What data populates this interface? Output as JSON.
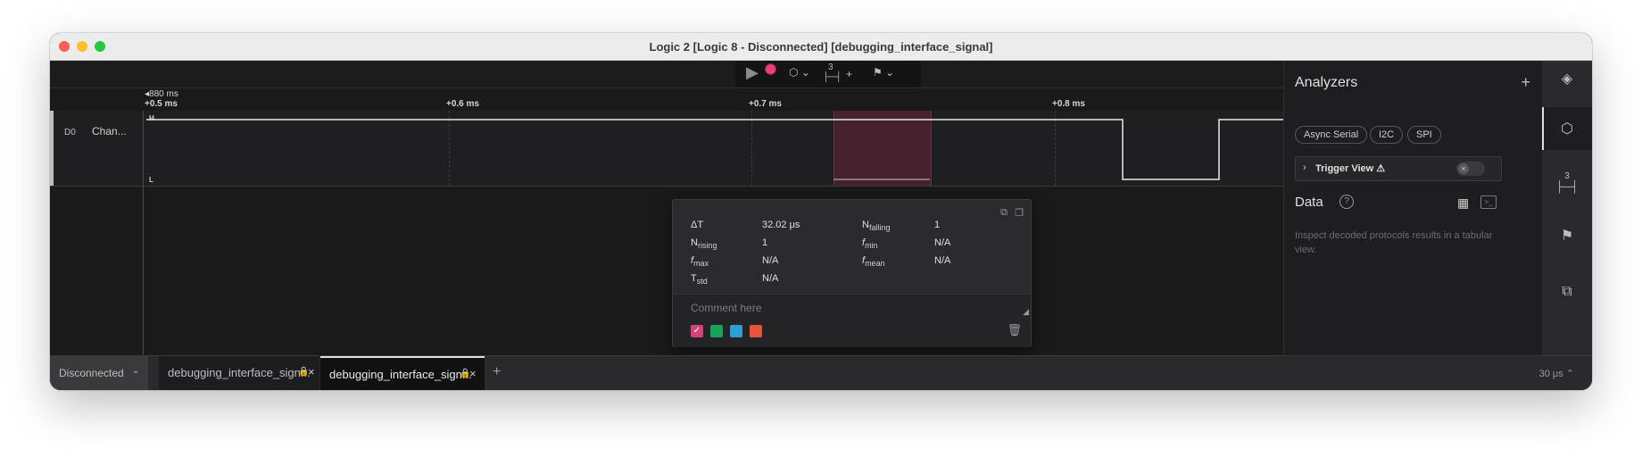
{
  "window": {
    "title": "Logic 2 [Logic 8 - Disconnected] [debugging_interface_signal]"
  },
  "toolbar": {
    "play_icon": "play-icon",
    "record_indicator_color": "#e64177",
    "trigger_icon": "trigger-icon",
    "timing_marker_label": "3",
    "timing_marker_plus": "+",
    "markers_icon": "flag-icon"
  },
  "ruler": {
    "reference": "880 ms",
    "ticks": [
      "+0.5 ms",
      "+0.6 ms",
      "+0.7 ms",
      "+0.8 ms"
    ]
  },
  "channel": {
    "id": "D0",
    "name": "Chan...",
    "high": "H",
    "low": "L"
  },
  "measurement": {
    "delta_t_label": "ΔT",
    "delta_t_value": "32.02 μs",
    "n_falling_label": "N",
    "n_falling_sub": "falling",
    "n_falling_value": "1",
    "n_rising_label": "N",
    "n_rising_sub": "rising",
    "n_rising_value": "1",
    "f_min_label": "f",
    "f_min_sub": "min",
    "f_min_value": "N/A",
    "f_max_label": "f",
    "f_max_sub": "max",
    "f_max_value": "N/A",
    "f_mean_label": "f",
    "f_mean_sub": "mean",
    "f_mean_value": "N/A",
    "t_std_label": "T",
    "t_std_sub": "std",
    "t_std_value": "N/A",
    "comment_placeholder": "Comment here",
    "swatch_colors": [
      "#d2427d",
      "#1aa25a",
      "#2e9ed8",
      "#e4553b"
    ]
  },
  "bottom": {
    "device_status": "Disconnected",
    "tabs": [
      {
        "label": "debugging_interface_sign..."
      },
      {
        "label": "debugging_interface_sign..."
      }
    ],
    "add_tab": "+",
    "span": "30 μs"
  },
  "analyzers": {
    "title": "Analyzers",
    "add": "+",
    "chips": [
      "Async Serial",
      "I2C",
      "SPI"
    ],
    "trigger_view": "Trigger View ⚠",
    "data_title": "Data",
    "help": "?",
    "description": "Inspect decoded protocols results in a tabular view."
  },
  "sidebar": {
    "icons": [
      "device-icon",
      "analyzers-icon",
      "timing-marker-icon",
      "markers-icon",
      "extensions-icon"
    ],
    "timing_label": "3"
  }
}
